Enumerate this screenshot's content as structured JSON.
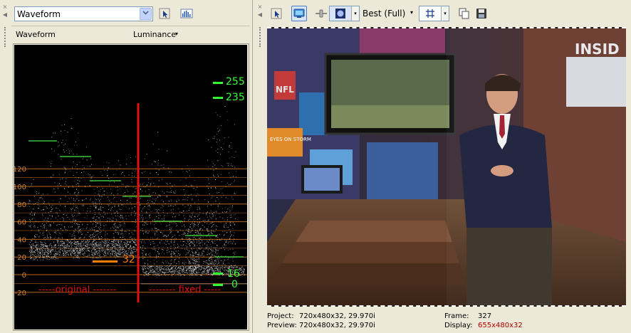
{
  "left_panel": {
    "close_glyph": "×",
    "collapse_glyph": "◀",
    "scope_select": {
      "value": "Waveform"
    },
    "select_arrow_icon": "chevron-down-icon",
    "buttons": [
      {
        "name": "scope-settings-button",
        "icon": "cursor-pointer-icon"
      },
      {
        "name": "histogram-button",
        "icon": "histogram-icon"
      }
    ],
    "scope_title": "Waveform",
    "mode_menu": "Luminance",
    "mode_arrow": "▾"
  },
  "waveform": {
    "y_ticks": [
      "120",
      "100",
      "80",
      "60",
      "40",
      "20",
      "0",
      "-20"
    ],
    "markers_right": [
      "255",
      "235",
      "16",
      "0"
    ],
    "marker_mid": "32",
    "label_original": "-----original -------",
    "label_fixed": "-------- fixed -----",
    "colors": {
      "background": "#000000",
      "gridline": "#c06a1a",
      "tick_text": "#d08030",
      "marker_green": "#33ff33",
      "marker_orange": "#ff7f00",
      "divider_red": "#e01010",
      "trace": "#d8d8d8"
    }
  },
  "right_panel": {
    "close_glyph": "×",
    "collapse_glyph": "◀",
    "quality": "Best (Full)",
    "quality_arrow": "▾",
    "combo_arrow": "▾",
    "buttons": [
      {
        "name": "preview-settings-button",
        "icon": "cursor-pointer-icon"
      },
      {
        "name": "external-monitor-button",
        "icon": "monitor-icon"
      },
      {
        "name": "split-screen-button",
        "icon": "split-icon"
      },
      {
        "name": "overlays-button",
        "icon": "overlay-icon"
      },
      {
        "name": "grid-button",
        "icon": "grid-icon"
      },
      {
        "name": "copy-snapshot-button",
        "icon": "copy-icon"
      },
      {
        "name": "save-snapshot-button",
        "icon": "save-icon"
      }
    ],
    "info": {
      "project_label": "Project:",
      "project_value": "720x480x32, 29.970i",
      "preview_label": "Preview:",
      "preview_value": "720x480x32, 29.970i",
      "frame_label": "Frame:",
      "frame_value": "327",
      "display_label": "Display:",
      "display_value": "655x480x32"
    },
    "video_text": {
      "top_right": "INSID",
      "screen_left": "NFL",
      "screen_small": "EYES ON STORM"
    }
  }
}
